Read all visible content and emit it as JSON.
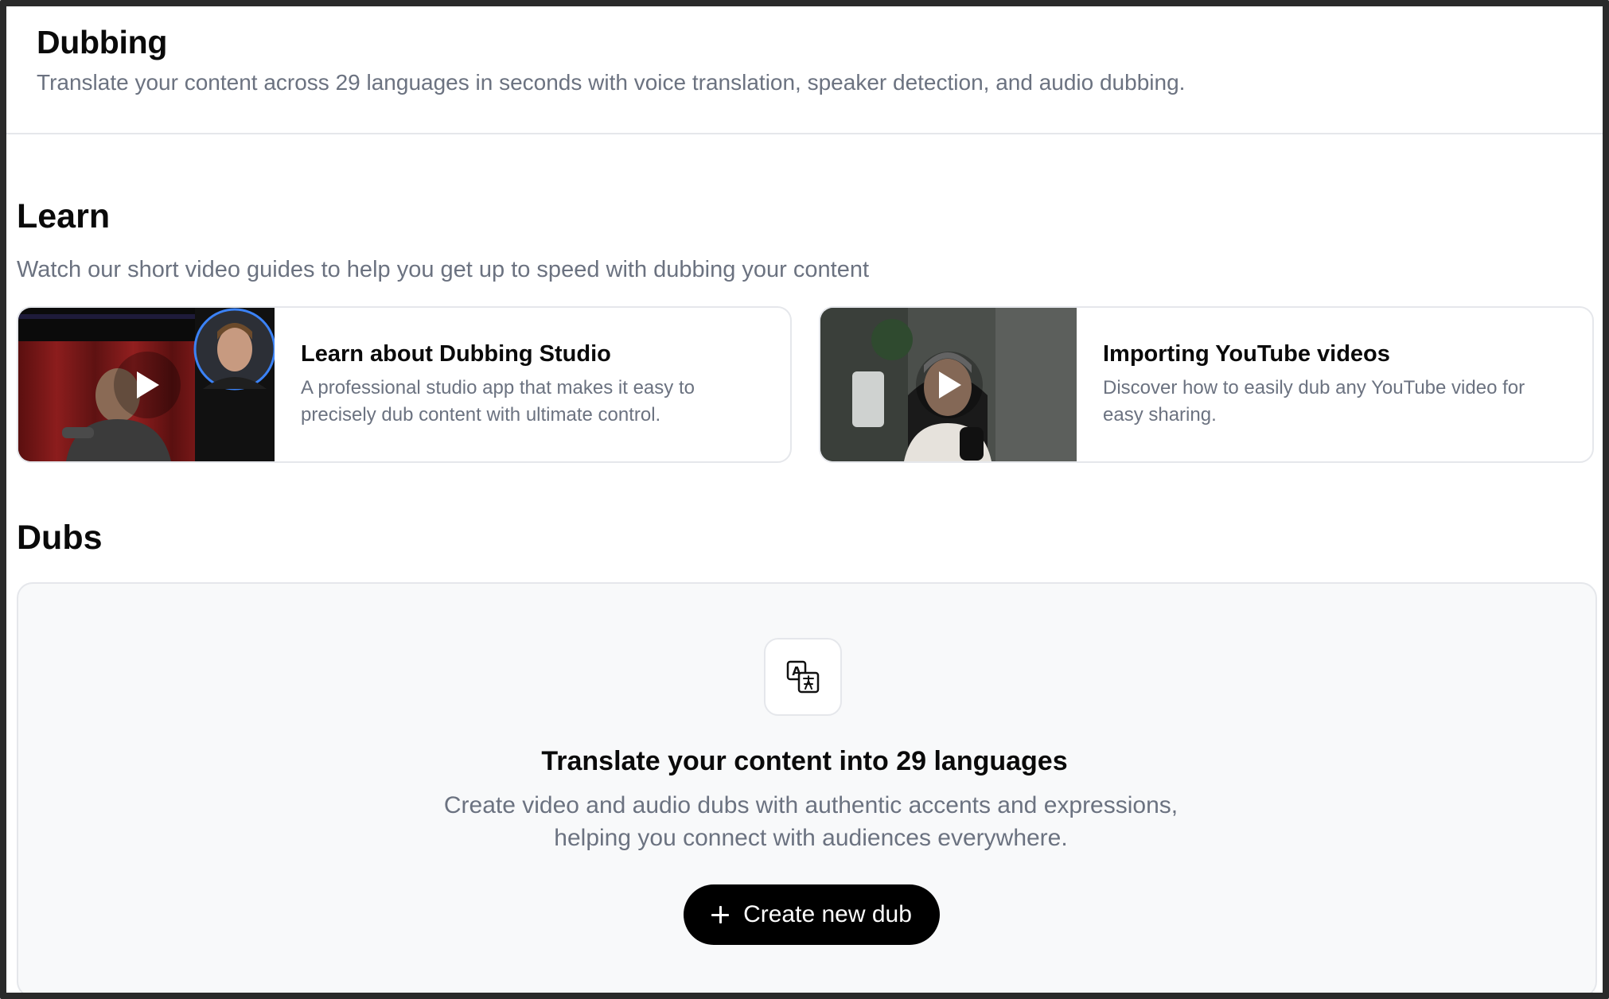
{
  "header": {
    "title": "Dubbing",
    "subtitle": "Translate your content across 29 languages in seconds with voice translation, speaker detection, and audio dubbing."
  },
  "learn": {
    "title": "Learn",
    "description": "Watch our short video guides to help you get up to speed with dubbing your content",
    "cards": [
      {
        "title": "Learn about Dubbing Studio",
        "description": "A professional studio app that makes it easy to precisely dub content with ultimate control.",
        "thumbnail_icon": "play-icon"
      },
      {
        "title": "Importing YouTube videos",
        "description": "Discover how to easily dub any YouTube video for easy sharing.",
        "thumbnail_icon": "play-icon"
      }
    ]
  },
  "dubs": {
    "title": "Dubs",
    "empty_state": {
      "icon": "translate-icon",
      "title": "Translate your content into 29 languages",
      "description": "Create video and audio dubs with authentic accents and expressions, helping you connect with audiences everywhere.",
      "button_label": "Create new dub",
      "button_icon": "plus-icon"
    }
  },
  "colors": {
    "primary_button": "#000000",
    "muted_text": "#6b7280",
    "panel_bg": "#f8f9fa",
    "border": "#e5e7eb"
  }
}
